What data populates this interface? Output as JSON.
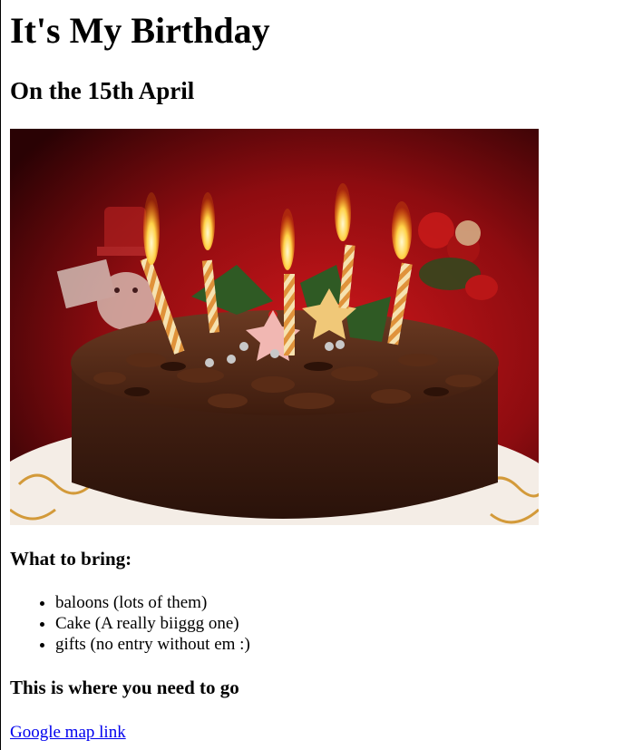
{
  "page": {
    "title": "It's My Birthday",
    "subtitle": "On the 15th April"
  },
  "image": {
    "alt": "Chocolate birthday cake with candles",
    "description_icon": "birthday-cake-photo"
  },
  "bring": {
    "heading": "What to bring:",
    "items": [
      "baloons (lots of them)",
      "Cake (A really biiggg one)",
      "gifts (no entry without em :)"
    ]
  },
  "directions": {
    "heading": "This is where you need to go",
    "link_text": "Google map link"
  },
  "colors": {
    "link": "#0000ee",
    "text": "#000000",
    "background": "#ffffff"
  }
}
